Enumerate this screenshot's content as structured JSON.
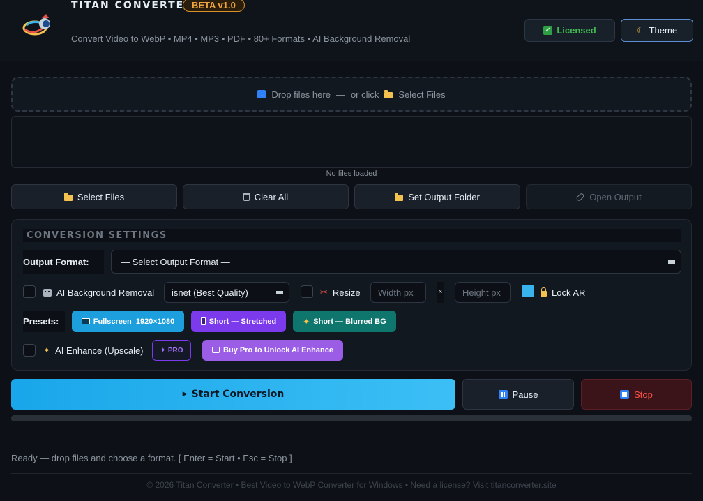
{
  "header": {
    "title": "TITAN CONVERTER",
    "badge": "BETA v1.0",
    "subtitle": "Convert Video to WebP • MP4 • MP3 • PDF • 80+ Formats • AI Background Removal",
    "licensed_label": "Licensed",
    "theme_label": "Theme"
  },
  "dropzone": {
    "drop_text": "Drop files here",
    "separator": "—",
    "or_click": "or click",
    "select_label": "Select Files"
  },
  "filelist": {
    "empty_text": "No files loaded"
  },
  "actions": {
    "select_files": "Select Files",
    "clear_all": "Clear All",
    "set_output": "Set Output Folder",
    "open_output": "Open Output"
  },
  "settings": {
    "title": "CONVERSION SETTINGS",
    "output_format_label": "Output Format:",
    "output_format_value": "— Select Output Format —",
    "ai_bg_label": "AI Background Removal",
    "ai_bg_model": "isnet (Best Quality)",
    "resize_label": "Resize",
    "width_placeholder": "Width px",
    "times": "×",
    "height_placeholder": "Height px",
    "lock_ar_label": "Lock AR",
    "lock_ar_checked": true,
    "presets_label": "Presets:",
    "presets": [
      {
        "label": "Fullscreen  1920×1080"
      },
      {
        "label": "Short — Stretched"
      },
      {
        "label": "Short — Blurred BG"
      }
    ],
    "ai_enhance_label": "AI Enhance (Upscale)",
    "pro_badge": "PRO",
    "buy_pro": "Buy Pro to Unlock AI Enhance"
  },
  "controls": {
    "start": "Start Conversion",
    "pause": "Pause",
    "stop": "Stop",
    "progress": 0
  },
  "status": "Ready — drop files and choose a format. [ Enter = Start • Esc = Stop ]",
  "footer": "© 2026 Titan Converter • Best Video to WebP Converter for Windows • Need a license? Visit titanconverter.site",
  "colors": {
    "accent": "#38b3ee",
    "licensed": "#3fb950",
    "beta": "#f0a640",
    "stop": "#f85149",
    "purple": "#7c3aed",
    "teal": "#0f766e"
  }
}
